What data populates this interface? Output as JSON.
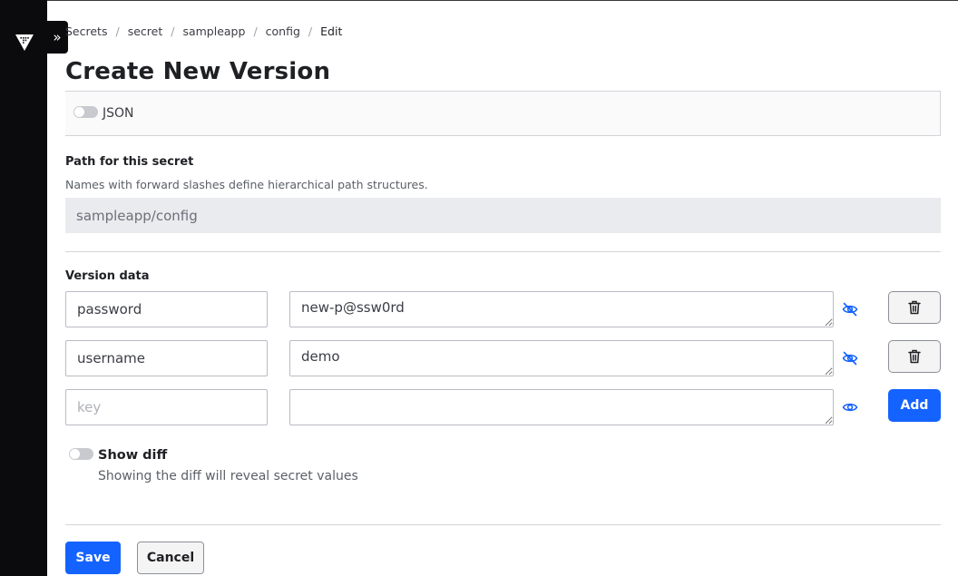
{
  "breadcrumb": [
    {
      "label": "Secrets"
    },
    {
      "label": "secret"
    },
    {
      "label": "sampleapp"
    },
    {
      "label": "config"
    },
    {
      "label": "Edit"
    }
  ],
  "breadcrumb_separator": "/",
  "sidebar": {
    "expand_icon": "»"
  },
  "page_title": "Create New Version",
  "json_toggle": {
    "label": "JSON",
    "enabled": false
  },
  "path": {
    "label": "Path for this secret",
    "help": "Names with forward slashes define hierarchical path structures.",
    "value": "sampleapp/config"
  },
  "version_data": {
    "label": "Version data",
    "rows": [
      {
        "key": "password",
        "value": "new-p@ssw0rd",
        "visibility_icon": "eye-off-icon",
        "action_icon": "trash-icon"
      },
      {
        "key": "username",
        "value": "demo",
        "visibility_icon": "eye-off-icon",
        "action_icon": "trash-icon"
      },
      {
        "key": "",
        "key_placeholder": "key",
        "value": "",
        "visibility_icon": "eye-icon",
        "action_label": "Add"
      }
    ]
  },
  "show_diff": {
    "label": "Show diff",
    "help": "Showing the diff will reveal secret values",
    "enabled": false
  },
  "buttons": {
    "save": "Save",
    "cancel": "Cancel"
  },
  "colors": {
    "primary": "#1563ff",
    "sidebar": "#0b0b0d",
    "eye_icon": "#1563ff"
  }
}
